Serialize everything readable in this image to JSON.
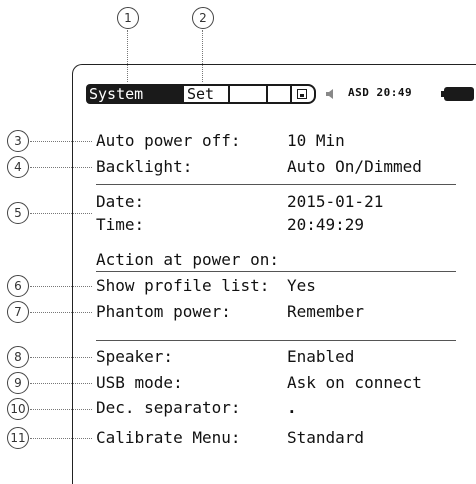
{
  "callouts": [
    "1",
    "2",
    "3",
    "4",
    "5",
    "6",
    "7",
    "8",
    "9",
    "10",
    "11"
  ],
  "tabs": {
    "system": "System",
    "set": "Set"
  },
  "status": {
    "text": "ASD 20:49",
    "icons": [
      "save-icon",
      "speaker-icon",
      "battery-icon"
    ]
  },
  "settings": {
    "auto_power_off": {
      "label": "Auto power off:",
      "value": "10 Min"
    },
    "backlight": {
      "label": "Backlight:",
      "value": "Auto On/Dimmed"
    },
    "date": {
      "label": "Date:",
      "value": "2015-01-21"
    },
    "time": {
      "label": "Time:",
      "value": "20:49:29"
    },
    "action_heading": "Action at power on:",
    "show_profile_list": {
      "label": "Show profile list:",
      "value": "Yes"
    },
    "phantom_power": {
      "label": "Phantom power:",
      "value": "Remember"
    },
    "speaker": {
      "label": "Speaker:",
      "value": "Enabled"
    },
    "usb_mode": {
      "label": "USB mode:",
      "value": "Ask on connect"
    },
    "dec_separator": {
      "label": "Dec. separator:",
      "value": "."
    },
    "calibrate_menu": {
      "label": "Calibrate Menu:",
      "value": "Standard"
    }
  },
  "colors": {
    "ink": "#111111",
    "tab_active_bg": "#1a1a1a",
    "leader": "#777777"
  }
}
